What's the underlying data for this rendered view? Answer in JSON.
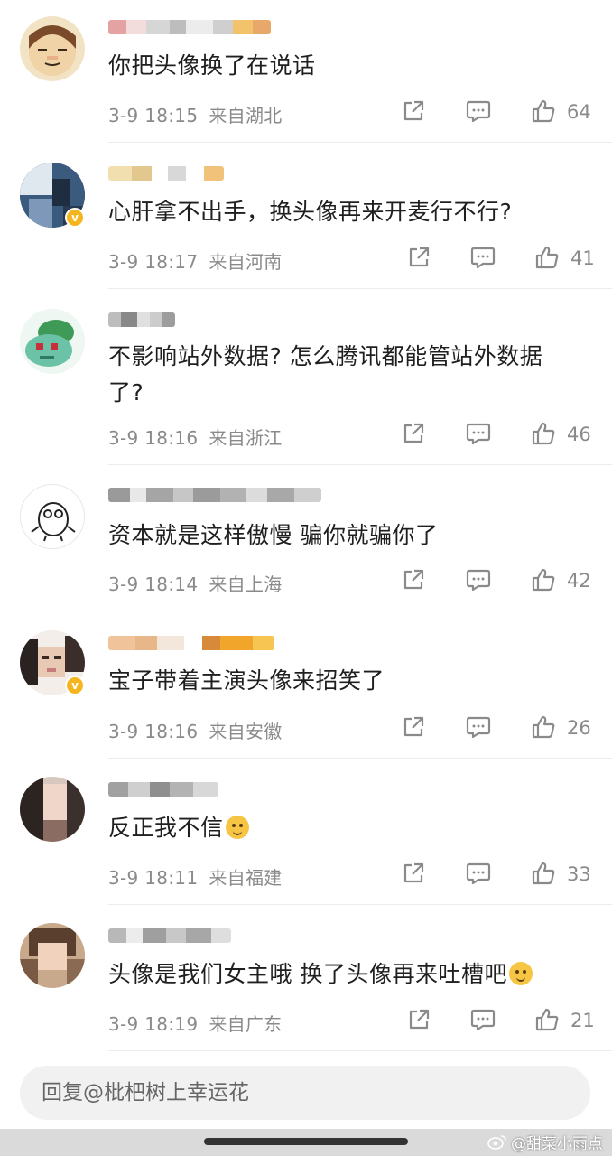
{
  "comments": [
    {
      "text": "你把头像换了在说话",
      "time": "3-9 18:15",
      "location": "来自湖北",
      "likes": "64",
      "verified": false
    },
    {
      "text": "心肝拿不出手，换头像再来开麦行不行?",
      "time": "3-9 18:17",
      "location": "来自河南",
      "likes": "41",
      "verified": true
    },
    {
      "text": "不影响站外数据? 怎么腾讯都能管站外数据了?",
      "time": "3-9 18:16",
      "location": "来自浙江",
      "likes": "46",
      "verified": false
    },
    {
      "text": "资本就是这样傲慢 骗你就骗你了",
      "time": "3-9 18:14",
      "location": "来自上海",
      "likes": "42",
      "verified": false
    },
    {
      "text": "宝子带着主演头像来招笑了",
      "time": "3-9 18:16",
      "location": "来自安徽",
      "likes": "26",
      "verified": true
    },
    {
      "text": "反正我不信",
      "time": "3-9 18:11",
      "location": "来自福建",
      "likes": "33",
      "verified": false
    },
    {
      "text": "头像是我们女主哦 换了头像再来吐槽吧",
      "time": "3-9 18:19",
      "location": "来自广东",
      "likes": "21",
      "verified": false
    }
  ],
  "reply": {
    "placeholder": "回复@枇杷树上幸运花"
  },
  "watermark": {
    "text": "@甜菜小雨点"
  },
  "colors": {
    "text": "#1f1f1f",
    "meta": "#8a8a8a",
    "divider": "#ececec",
    "verified_badge": "#f5b51d",
    "reply_bg": "#f1f1f1"
  },
  "icons": {
    "share": "share-icon",
    "comment": "comment-icon",
    "like": "thumbs-up-icon"
  }
}
